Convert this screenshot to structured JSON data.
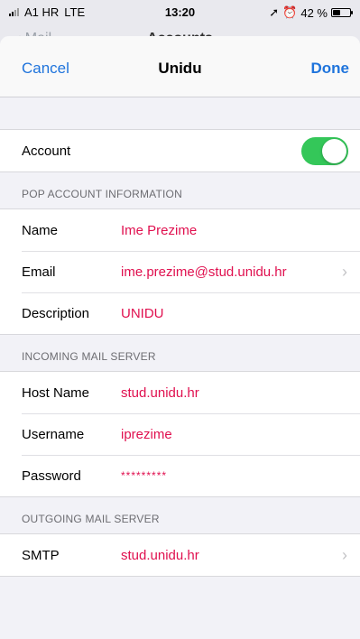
{
  "status": {
    "carrier": "A1 HR",
    "network": "LTE",
    "time": "13:20",
    "battery": "42 %",
    "battery_level": 0.42
  },
  "behind": {
    "back_label": "Mail",
    "title": "Accounts"
  },
  "nav": {
    "cancel_label": "Cancel",
    "title": "Unidu",
    "done_label": "Done"
  },
  "account": {
    "label": "Account",
    "enabled": true
  },
  "pop": {
    "header": "POP ACCOUNT INFORMATION",
    "name_label": "Name",
    "name_value": "Ime Prezime",
    "email_label": "Email",
    "email_value": "ime.prezime@stud.unidu.hr",
    "description_label": "Description",
    "description_value": "UNIDU"
  },
  "incoming": {
    "header": "INCOMING MAIL SERVER",
    "host_label": "Host Name",
    "host_value": "stud.unidu.hr",
    "username_label": "Username",
    "username_value": "iprezime",
    "password_label": "Password",
    "password_value": "*********"
  },
  "outgoing": {
    "header": "OUTGOING MAIL SERVER",
    "smtp_label": "SMTP",
    "smtp_value": "stud.unidu.hr"
  }
}
